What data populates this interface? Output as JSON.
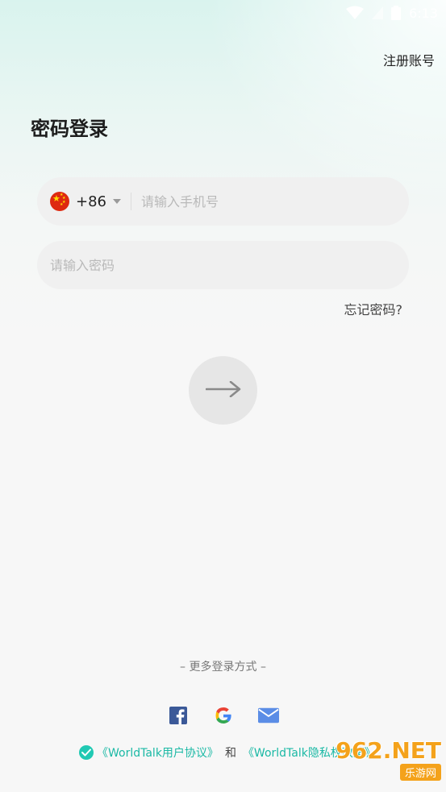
{
  "status_bar": {
    "time": "6:13"
  },
  "header": {
    "register_label": "注册账号"
  },
  "page": {
    "title": "密码登录"
  },
  "phone": {
    "country_code": "+86",
    "placeholder": "请输入手机号"
  },
  "password": {
    "placeholder": "请输入密码"
  },
  "forgot_label": "忘记密码?",
  "more_login_label": "– 更多登录方式 –",
  "social": [
    "facebook-icon",
    "google-icon",
    "mail-icon"
  ],
  "agreement": {
    "user_agreement": "《WorldTalk用户协议》",
    "and": "和",
    "privacy_policy": "《WorldTalk隐私权政策》"
  },
  "watermark": {
    "top": "962.NET",
    "bottom": "乐游网"
  },
  "colors": {
    "accent": "#1bb9a5",
    "check": "#20c9b3",
    "flag_red": "#de2910",
    "flag_star": "#ffde00"
  }
}
